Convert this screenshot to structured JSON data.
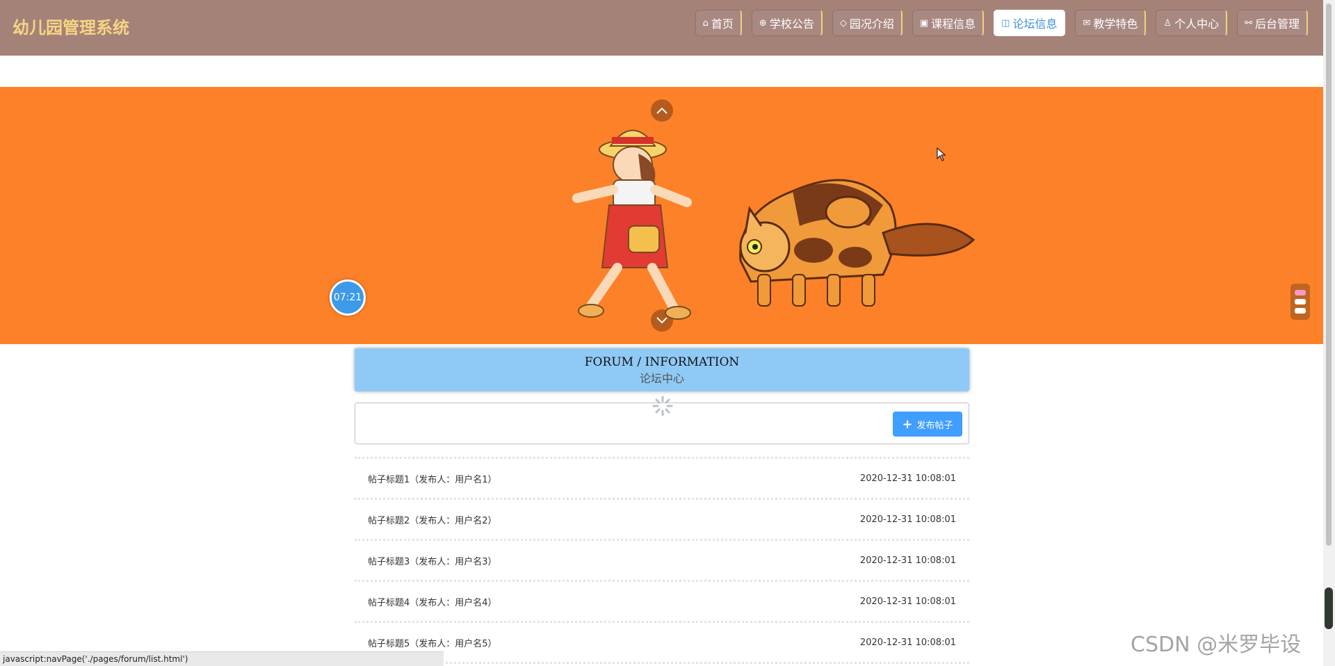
{
  "app": {
    "title": "幼儿园管理系统"
  },
  "nav": [
    {
      "icon": "home-icon",
      "glyph": "⌂",
      "label": "首页",
      "active": false
    },
    {
      "icon": "globe-icon",
      "glyph": "⊕",
      "label": "学校公告",
      "active": false
    },
    {
      "icon": "tag-icon",
      "glyph": "◇",
      "label": "园况介绍",
      "active": false
    },
    {
      "icon": "gift-icon",
      "glyph": "▣",
      "label": "课程信息",
      "active": false
    },
    {
      "icon": "book-icon",
      "glyph": "◫",
      "label": "论坛信息",
      "active": true
    },
    {
      "icon": "mail-icon",
      "glyph": "✉",
      "label": "教学特色",
      "active": false
    },
    {
      "icon": "user-icon",
      "glyph": "♙",
      "label": "个人中心",
      "active": false
    },
    {
      "icon": "link-icon",
      "glyph": "⚯",
      "label": "后台管理",
      "active": false
    }
  ],
  "banner": {
    "clock_text": "07:21"
  },
  "forum": {
    "title_en": "FORUM / INFORMATION",
    "title_cn": "论坛中心",
    "post_button": "发布帖子",
    "posts": [
      {
        "title": "帖子标题1（发布人：用户名1）",
        "time": "2020-12-31 10:08:01"
      },
      {
        "title": "帖子标题2（发布人：用户名2）",
        "time": "2020-12-31 10:08:01"
      },
      {
        "title": "帖子标题3（发布人：用户名3）",
        "time": "2020-12-31 10:08:01"
      },
      {
        "title": "帖子标题4（发布人：用户名4）",
        "time": "2020-12-31 10:08:01"
      },
      {
        "title": "帖子标题5（发布人：用户名5）",
        "time": "2020-12-31 10:08:01"
      }
    ]
  },
  "statusbar": {
    "text": "javascript:navPage('./pages/forum/list.html')"
  },
  "watermark": "CSDN @米罗毕设",
  "colors": {
    "header": "#a58278",
    "brand": "#f6d583",
    "banner": "#fd8128",
    "forum_title_bg": "#8fcaf6",
    "accent": "#409eff"
  }
}
